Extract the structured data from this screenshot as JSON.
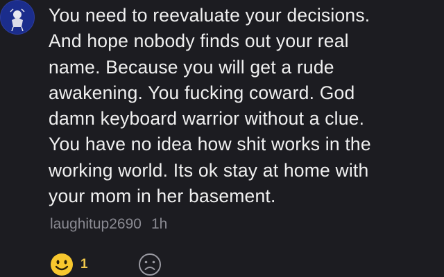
{
  "comment": {
    "line1": "You need to reevaluate your decisions.",
    "line2": "And hope nobody finds out your real",
    "line3": "name. Because you will get a rude",
    "line4": "awakening. You fucking coward. God",
    "line5": "damn keyboard warrior without a clue.",
    "line6": "You have no idea how shit works in the",
    "line7": "working world. Its ok stay at home with",
    "line8": "your mom in her basement.",
    "username": "laughitup2690",
    "time": "1h"
  },
  "reactions": {
    "like_count": "1",
    "like_color": "#f7c72e",
    "like_icon": "smile-face-icon",
    "dislike_icon": "sad-face-icon"
  },
  "colors": {
    "background": "#1c1c21",
    "text": "#f0f0f0",
    "meta": "#8a8a92",
    "avatar_bg": "#1b2d8c"
  }
}
